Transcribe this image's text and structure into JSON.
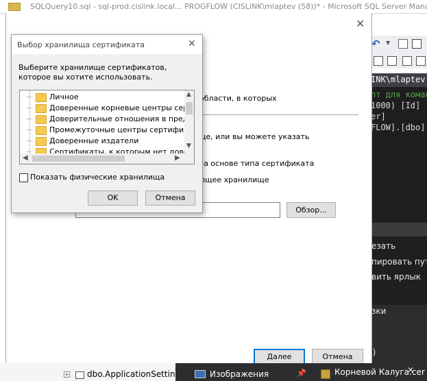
{
  "ssms": {
    "title": "SQLQuery10.sql - sql-prod.cislink.local... PROGFLOW (CISLINK\\mlaptev (58))* - Microsoft SQL Server Management Studio",
    "tab_header": "INK\\mlaptev",
    "code_lines": [
      "пт для коман",
      "1000) [Id]",
      "er]",
      "FLOW].[dbo]."
    ],
    "context_menu_items": [
      "езать",
      "пировать путь",
      "вить ярлык"
    ],
    "context_menu2_items": [
      "зки",
      "1)"
    ],
    "tree_item": "dbo.ApplicationSetting",
    "tabs": {
      "images": "Изображения",
      "certificate": "Корневой Калуга.cer",
      "certificate_close": "✕",
      "pin": "📌"
    }
  },
  "wizard": {
    "close_glyph": "✕",
    "text_areas": "области, в которых",
    "text_can_specify": "ще, или вы можете указать",
    "text_by_type": "на основе типа сертификата",
    "text_store": "ющее хранилище",
    "path_value": "",
    "browse_button": "Обзор...",
    "next_button": "Далее",
    "cancel_button": "Отмена"
  },
  "dialog": {
    "title": "Выбор хранилища сертификата",
    "close_glyph": "✕",
    "prompt": "Выберите хранилище сертификатов, которое вы хотите использовать.",
    "stores": [
      "Личное",
      "Доверенные корневые центры сертиф",
      "Доверительные отношения в предпри",
      "Промежуточные центры сертификаци",
      "Доверенные издатели",
      "Сертификаты, к которым нет довери"
    ],
    "show_physical_checkbox": "Показать физические хранилища",
    "show_physical_checked": false,
    "ok_button": "OK",
    "cancel_button": "Отмена"
  }
}
